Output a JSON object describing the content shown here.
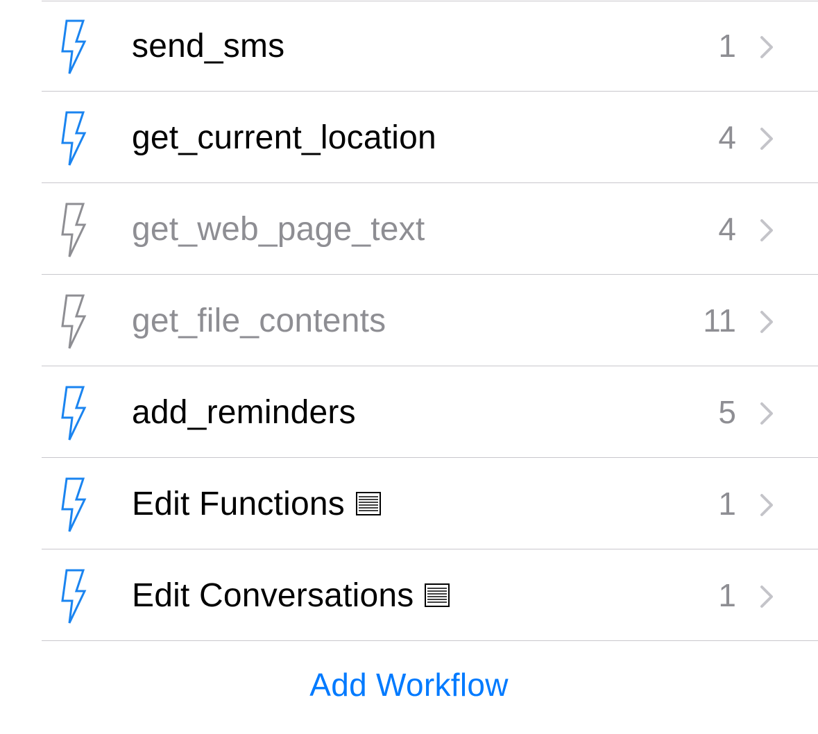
{
  "colors": {
    "accent": "#007aff",
    "enabled_icon": "#1a84f0",
    "disabled_icon": "#8e8e93",
    "enabled_text": "#000000",
    "disabled_text": "#8e8e93",
    "count_text": "#8e8e93",
    "chevron": "#c4c4c9",
    "divider": "#c8c7cc"
  },
  "workflows": [
    {
      "icon": "lightning-bolt-icon",
      "name": "send_sms",
      "count": "1",
      "enabled": true,
      "has_doc_glyph": false
    },
    {
      "icon": "lightning-bolt-icon",
      "name": "get_current_location",
      "count": "4",
      "enabled": true,
      "has_doc_glyph": false
    },
    {
      "icon": "lightning-bolt-icon",
      "name": "get_web_page_text",
      "count": "4",
      "enabled": false,
      "has_doc_glyph": false
    },
    {
      "icon": "lightning-bolt-icon",
      "name": "get_file_contents",
      "count": "11",
      "enabled": false,
      "has_doc_glyph": false
    },
    {
      "icon": "lightning-bolt-icon",
      "name": "add_reminders",
      "count": "5",
      "enabled": true,
      "has_doc_glyph": false
    },
    {
      "icon": "lightning-bolt-icon",
      "name": "Edit Functions",
      "count": "1",
      "enabled": true,
      "has_doc_glyph": true
    },
    {
      "icon": "lightning-bolt-icon",
      "name": "Edit Conversations",
      "count": "1",
      "enabled": true,
      "has_doc_glyph": true
    }
  ],
  "footer": {
    "add_workflow_label": "Add Workflow"
  }
}
